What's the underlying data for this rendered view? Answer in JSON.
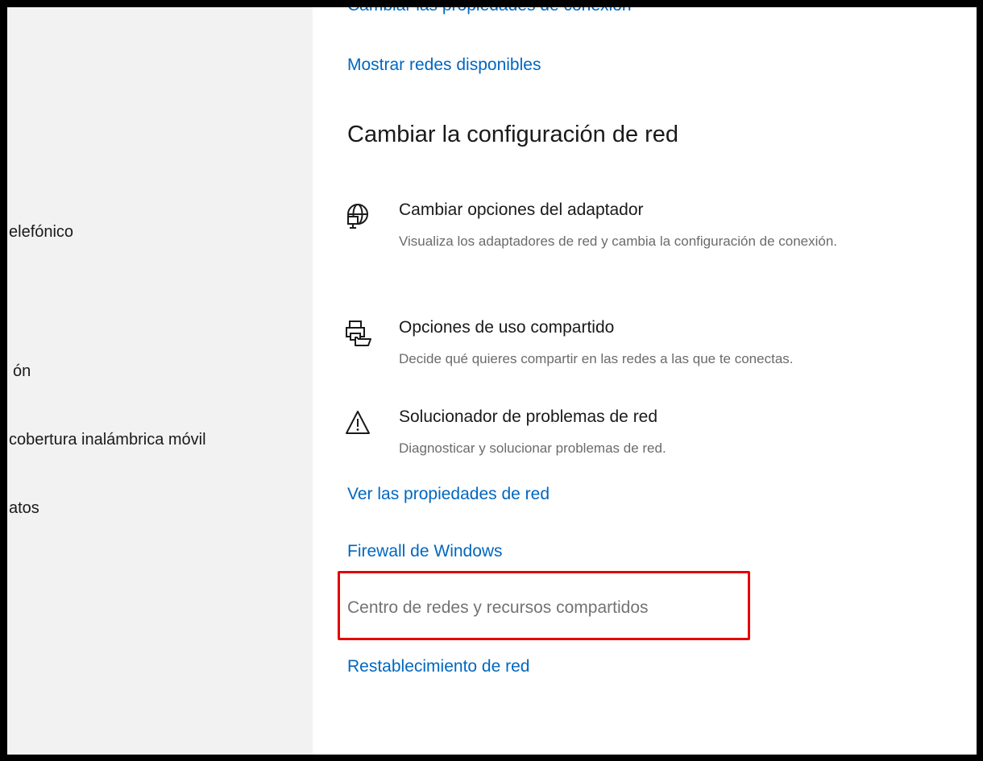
{
  "sidebar": {
    "items": [
      {
        "label": "elefónico"
      },
      {
        "label": "ón"
      },
      {
        "label": "cobertura inalámbrica móvil"
      },
      {
        "label": "atos"
      }
    ]
  },
  "content": {
    "top_link_cut": "Cambiar las propiedades de conexión",
    "show_networks_link": "Mostrar redes disponibles",
    "section_heading": "Cambiar la configuración de red",
    "options": [
      {
        "icon": "network-adapter-icon",
        "title": "Cambiar opciones del adaptador",
        "description": "Visualiza los adaptadores de red y cambia la configuración de conexión."
      },
      {
        "icon": "sharing-icon",
        "title": "Opciones de uso compartido",
        "description": "Decide qué quieres compartir en las redes a las que te conectas."
      },
      {
        "icon": "warning-icon",
        "title": "Solucionador de problemas de red",
        "description": "Diagnosticar y solucionar problemas de red."
      }
    ],
    "links": {
      "network_properties": "Ver las propiedades de red",
      "firewall": "Firewall de Windows",
      "network_center": "Centro de redes y recursos compartidos",
      "network_reset": "Restablecimiento de red"
    }
  },
  "colors": {
    "link": "#0067c0",
    "highlight": "#e60000",
    "sidebar_bg": "#f2f2f2"
  }
}
